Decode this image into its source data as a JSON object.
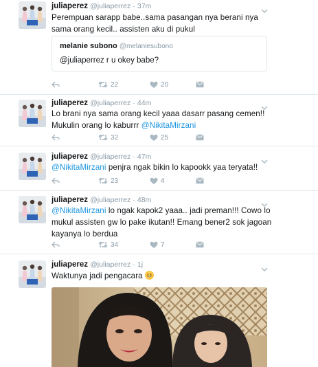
{
  "tweets": [
    {
      "name": "juliaperez",
      "handle": "@juliaperrez",
      "time": "37m",
      "segments": [
        {
          "text": "Perempuan sarapp babe..sama pasangan nya berani nya sama orang kecil.. assisten aku di pukul"
        }
      ],
      "quote": {
        "name": "melanie subono",
        "handle": "@melaniesubono",
        "text": "@juliaperrez r u okey babe?"
      },
      "retweets": "22",
      "likes": "20"
    },
    {
      "name": "juliaperez",
      "handle": "@juliaperrez",
      "time": "44m",
      "segments": [
        {
          "text": "Lo brani nya sama orang kecil yaaa dasarr pasang cemen!! Mukulin orang lo kaburrr "
        },
        {
          "text": "@NikitaMirzani",
          "mention": true
        }
      ],
      "retweets": "32",
      "likes": "25"
    },
    {
      "name": "juliaperez",
      "handle": "@juliaperrez",
      "time": "47m",
      "segments": [
        {
          "text": "@NikitaMirzani",
          "mention": true
        },
        {
          "text": " penjra ngak bikin lo kapookk yaa teryata!!"
        }
      ],
      "retweets": "23",
      "likes": "4"
    },
    {
      "name": "juliaperez",
      "handle": "@juliaperrez",
      "time": "48m",
      "segments": [
        {
          "text": "@NikitaMirzani",
          "mention": true
        },
        {
          "text": " lo ngak kapok2 yaaa.. jadi preman!!! Cowo lo mukul assisten gw lo pake ikutan!! Emang bener2 sok jagoan kayanya lo berdua"
        }
      ],
      "retweets": "34",
      "likes": "7"
    },
    {
      "name": "juliaperez",
      "handle": "@juliaperrez",
      "time": "1j",
      "segments": [
        {
          "text": "Waktunya jadi pengacara "
        }
      ],
      "emoji": "grinning-face-emoji"
    }
  ],
  "icons": {
    "reply": "reply-icon",
    "retweet": "retweet-icon",
    "like": "heart-icon",
    "dm": "direct-message-icon",
    "more": "chevron-down-icon"
  },
  "colors": {
    "mention": "#1b95e0",
    "meta": "#8899a6",
    "icon": "#aab8c2",
    "divider": "#e1e8ed"
  }
}
